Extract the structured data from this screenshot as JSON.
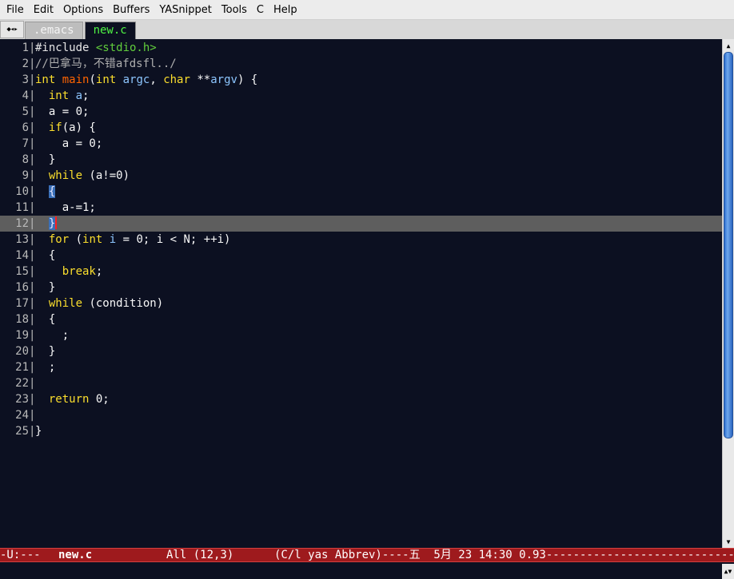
{
  "menu": [
    "File",
    "Edit",
    "Options",
    "Buffers",
    "YASnippet",
    "Tools",
    "C",
    "Help"
  ],
  "tabs": {
    "scroll_glyph": "◆◂▸",
    "items": [
      {
        "label": ".emacs",
        "active": false
      },
      {
        "label": "new.c",
        "active": true
      }
    ]
  },
  "editor": {
    "current_line": 12,
    "lines": [
      {
        "n": "1",
        "tokens": [
          [
            "pp",
            "#include "
          ],
          [
            "str",
            "<stdio.h>"
          ]
        ]
      },
      {
        "n": "2",
        "tokens": [
          [
            "cmt",
            "//巴拿马，不错afdsfl../"
          ]
        ]
      },
      {
        "n": "3",
        "tokens": [
          [
            "kw",
            "int"
          ],
          [
            "",
            " "
          ],
          [
            "fn",
            "main"
          ],
          [
            "",
            "("
          ],
          [
            "kw",
            "int"
          ],
          [
            "",
            " "
          ],
          [
            "var",
            "argc"
          ],
          [
            "",
            ", "
          ],
          [
            "kw",
            "char"
          ],
          [
            "",
            " **"
          ],
          [
            "var",
            "argv"
          ],
          [
            "",
            ") {"
          ]
        ]
      },
      {
        "n": "4",
        "tokens": [
          [
            "",
            "  "
          ],
          [
            "kw",
            "int"
          ],
          [
            "",
            " "
          ],
          [
            "var",
            "a"
          ],
          [
            "",
            ";"
          ]
        ]
      },
      {
        "n": "5",
        "tokens": [
          [
            "",
            "  a = 0;"
          ]
        ]
      },
      {
        "n": "6",
        "tokens": [
          [
            "",
            "  "
          ],
          [
            "kw",
            "if"
          ],
          [
            "",
            "(a) {"
          ]
        ]
      },
      {
        "n": "7",
        "tokens": [
          [
            "",
            "    a = 0;"
          ]
        ]
      },
      {
        "n": "8",
        "tokens": [
          [
            "",
            "  }"
          ]
        ]
      },
      {
        "n": "9",
        "tokens": [
          [
            "",
            "  "
          ],
          [
            "kw",
            "while"
          ],
          [
            "",
            " (a!=0)"
          ]
        ]
      },
      {
        "n": "10",
        "tokens": [
          [
            "",
            "  "
          ],
          [
            "brk-hl",
            "{"
          ]
        ]
      },
      {
        "n": "11",
        "tokens": [
          [
            "",
            "    a-=1;"
          ]
        ]
      },
      {
        "n": "12",
        "tokens": [
          [
            "",
            "  "
          ],
          [
            "brk-cur",
            "}"
          ],
          [
            "cursor",
            ""
          ]
        ]
      },
      {
        "n": "13",
        "tokens": [
          [
            "",
            "  "
          ],
          [
            "kw",
            "for"
          ],
          [
            "",
            " ("
          ],
          [
            "kw",
            "int"
          ],
          [
            "",
            " "
          ],
          [
            "var",
            "i"
          ],
          [
            "",
            " = 0; i < N; ++i)"
          ]
        ]
      },
      {
        "n": "14",
        "tokens": [
          [
            "",
            "  {"
          ]
        ]
      },
      {
        "n": "15",
        "tokens": [
          [
            "",
            "    "
          ],
          [
            "kw",
            "break"
          ],
          [
            "",
            ";"
          ]
        ]
      },
      {
        "n": "16",
        "tokens": [
          [
            "",
            "  }"
          ]
        ]
      },
      {
        "n": "17",
        "tokens": [
          [
            "",
            "  "
          ],
          [
            "kw",
            "while"
          ],
          [
            "",
            " (condition)"
          ]
        ]
      },
      {
        "n": "18",
        "tokens": [
          [
            "",
            "  {"
          ]
        ]
      },
      {
        "n": "19",
        "tokens": [
          [
            "",
            "    ;"
          ]
        ]
      },
      {
        "n": "20",
        "tokens": [
          [
            "",
            "  }"
          ]
        ]
      },
      {
        "n": "21",
        "tokens": [
          [
            "",
            "  ;"
          ]
        ]
      },
      {
        "n": "22",
        "tokens": [
          [
            "",
            ""
          ]
        ]
      },
      {
        "n": "23",
        "tokens": [
          [
            "",
            "  "
          ],
          [
            "kw",
            "return"
          ],
          [
            "",
            " 0;"
          ]
        ]
      },
      {
        "n": "24",
        "tokens": [
          [
            "",
            ""
          ]
        ]
      },
      {
        "n": "25",
        "tokens": [
          [
            "",
            "}"
          ]
        ]
      }
    ]
  },
  "scrollbar": {
    "up_glyph": "▲",
    "down_glyph": "▼"
  },
  "modeline": {
    "status": "-U:---",
    "buffer": "new.c",
    "position": "All (12,3)",
    "modes": "(C/l yas Abbrev)----五  5月 23 14:30 0.93-----------------------------------"
  },
  "echo": {
    "scroll_glyph": "▲▼"
  },
  "colors": {
    "background": "#0c1021",
    "keyword": "#fbde2d",
    "function": "#ff6400",
    "variable": "#8dc6ff",
    "string": "#61ce3c",
    "comment": "#aeaeae",
    "modeline_bg": "#9e1a1d",
    "current_line_bg": "#5e5e5e"
  }
}
